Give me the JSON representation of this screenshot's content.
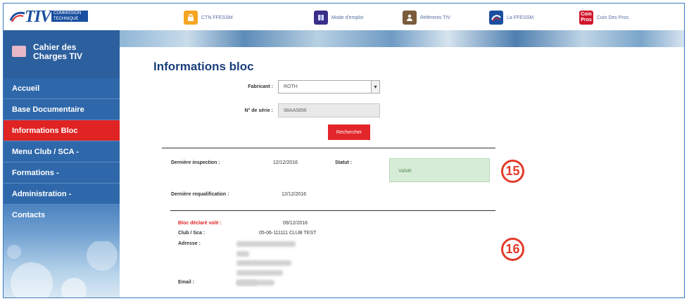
{
  "logo": {
    "brand": "TIV",
    "sub_line1": "COMMISSION",
    "sub_line2": "TECHNIQUE"
  },
  "topnav": [
    {
      "label": "CTN FFESSM",
      "icon": "padlock-icon",
      "color": "#f5a623"
    },
    {
      "label": "Mode d'emploi",
      "icon": "book-icon",
      "color": "#3b2e8a"
    },
    {
      "label": "Référents TIV",
      "icon": "users-icon",
      "color": "#7a5c3c"
    },
    {
      "label": "La FFESSM",
      "icon": "ffessm-icon",
      "color": "#1a4fa0"
    },
    {
      "label": "Coin Des Pros",
      "icon": "coin-pros-icon",
      "color": "#d0182e"
    }
  ],
  "sidebar": {
    "title_line1": "Cahier des",
    "title_line2": "Charges TIV",
    "items": [
      {
        "label": "Accueil"
      },
      {
        "label": "Base Documentaire"
      },
      {
        "label": "Informations Bloc",
        "active": true
      },
      {
        "label": "Menu Club / SCA -"
      },
      {
        "label": "Formations -"
      },
      {
        "label": "Administration -"
      },
      {
        "label": "Contacts"
      }
    ]
  },
  "main": {
    "title": "Informations bloc",
    "form": {
      "fabricant_label": "Fabricant :",
      "fabricant_value": "ROTH",
      "serie_label": "N° de série :",
      "serie_value": "98AA5896",
      "search_button": "Rechercher"
    },
    "inspection": {
      "derniere_inspection_label": "Dernière inspection :",
      "derniere_inspection_value": "12/12/2016",
      "statut_label": "Statut :",
      "statut_value": "Validé",
      "derniere_requalification_label": "Dernière requalification :",
      "derniere_requalification_value": "12/12/2016"
    },
    "declaration": {
      "vol_label": "Bloc déclaré volé :",
      "vol_value": "09/12/2016",
      "club_label": "Club / Sca :",
      "club_value": "05-06-111111 CLUB TEST",
      "adresse_label": "Adresse :",
      "email_label": "Email :"
    },
    "callouts": [
      "15",
      "16"
    ]
  }
}
